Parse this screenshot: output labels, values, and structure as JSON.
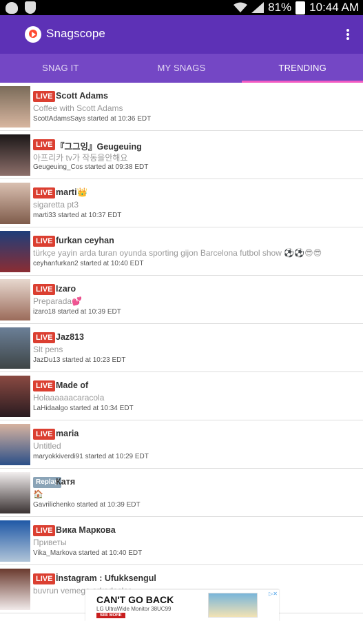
{
  "status_bar": {
    "battery": "81%",
    "time": "10:44 AM",
    "icons": [
      "play-icon",
      "shield-icon",
      "wifi-icon",
      "signal-icon",
      "battery-icon"
    ]
  },
  "app": {
    "title": "Snagscope",
    "icon": "record-logo-icon",
    "menu_icon": "more-vertical-icon"
  },
  "tabs": [
    {
      "label": "SNAG IT",
      "active": false
    },
    {
      "label": "MY SNAGS",
      "active": false
    },
    {
      "label": "TRENDING",
      "active": true
    }
  ],
  "rows": [
    {
      "type": "LIVE",
      "name": "Scott Adams",
      "subtitle": "Coffee with Scott Adams",
      "meta": "ScottAdamsSays started at 10:36 EDT"
    },
    {
      "type": "LIVE",
      "name": "『그그잉』Geugeuing",
      "subtitle": "아프리카 tv가 작동을안해요",
      "meta": "Geugeuing_Cos started at 09:38 EDT"
    },
    {
      "type": "LIVE",
      "name": "marti👑",
      "subtitle": "sigaretta pt3",
      "meta": "marti33 started at 10:37 EDT"
    },
    {
      "type": "LIVE",
      "name": "furkan ceyhan",
      "subtitle": "türkçe yayin arda turan oyunda sporting gijon Barcelona futbol show ⚽⚽😎😎",
      "meta": "ceyhanfurkan2 started at 10:40 EDT"
    },
    {
      "type": "LIVE",
      "name": "Izaro",
      "subtitle": "Preparada💕",
      "meta": "izaro18 started at 10:39 EDT"
    },
    {
      "type": "LIVE",
      "name": "Jaz813",
      "subtitle": "Slt pens",
      "meta": "JazDu13 started at 10:23 EDT"
    },
    {
      "type": "LIVE",
      "name": "Made of",
      "subtitle": "Holaaaaaacaracola",
      "meta": "LaHidaalgo started at 10:34 EDT"
    },
    {
      "type": "LIVE",
      "name": "maria",
      "subtitle": "Untitled",
      "meta": "maryokkiverdi91 started at 10:29 EDT"
    },
    {
      "type": "Replay",
      "name": "Катя",
      "subtitle": "🏠",
      "meta": "Gavrilichenko started at 10:39 EDT"
    },
    {
      "type": "LIVE",
      "name": "Вика Маркова",
      "subtitle": "Приветы",
      "meta": "Vika_Markova started at 10:40 EDT"
    },
    {
      "type": "LIVE",
      "name": "İnstagram : Ufukksengul",
      "subtitle": "buvrun vemege arkadaslar",
      "meta": ""
    }
  ],
  "ad": {
    "headline": "CAN'T GO BACK",
    "subtitle": "LG UltraWide Monitor 38UC99",
    "button": "SEE MORE",
    "close": "▷✕"
  }
}
